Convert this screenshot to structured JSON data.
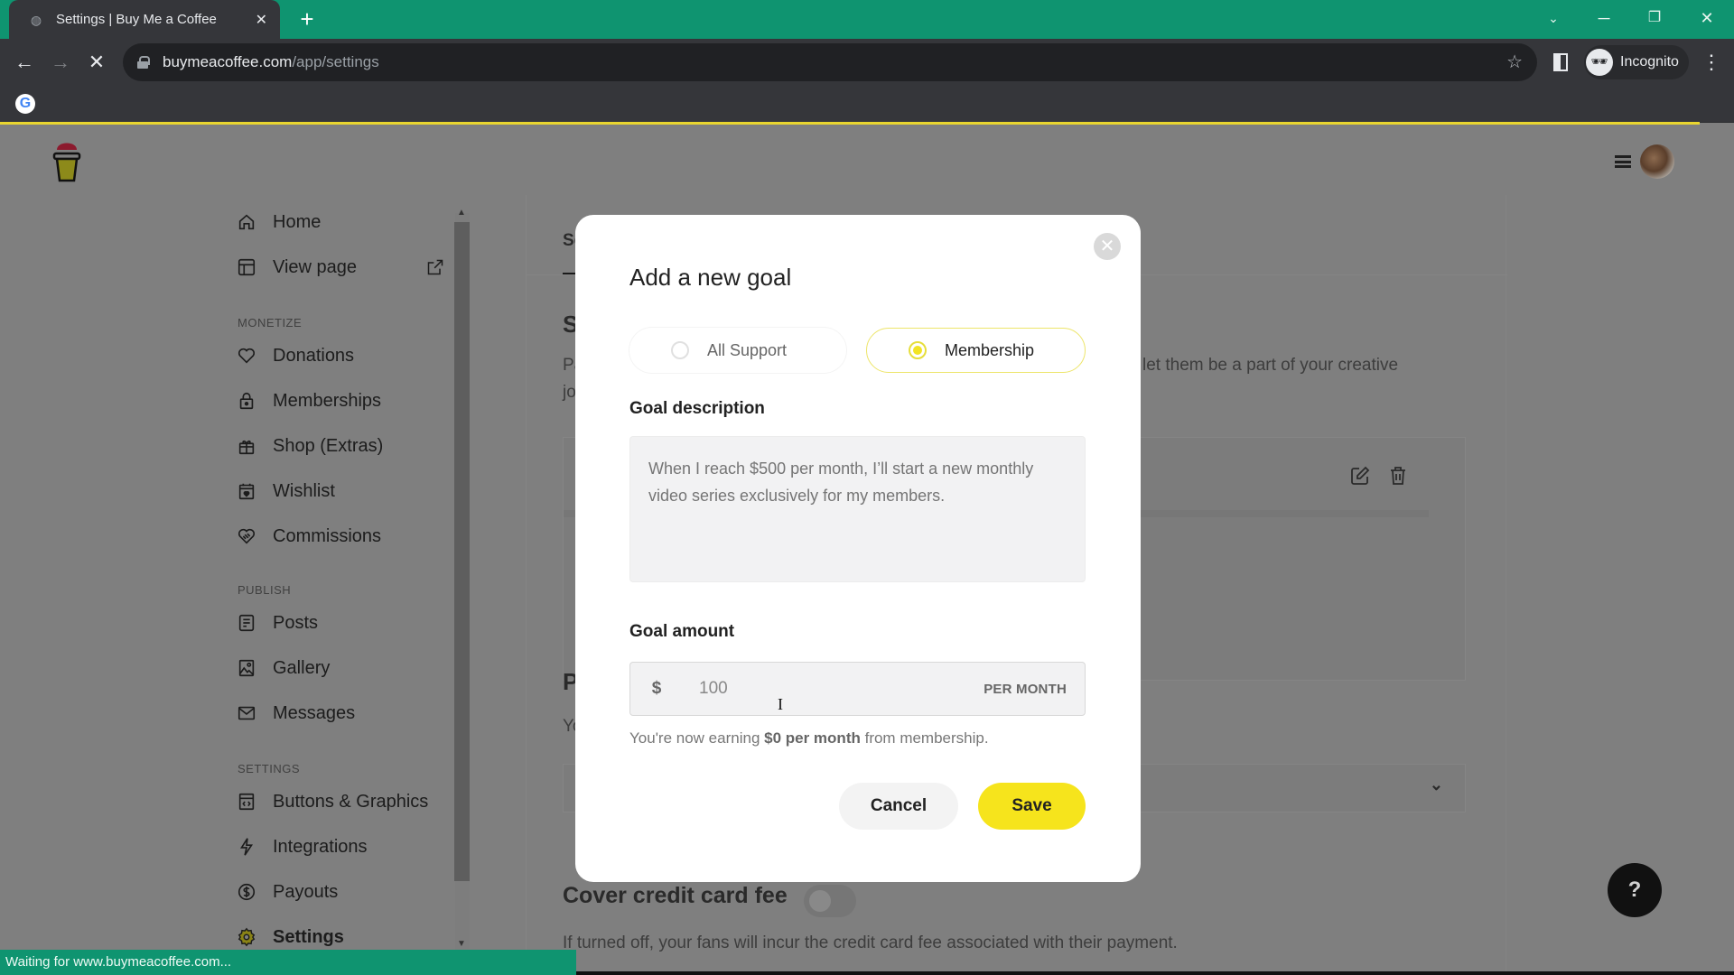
{
  "browser": {
    "tab_title": "Settings | Buy Me a Coffee",
    "tab_favicon": "globe-icon",
    "new_tab_label": "+",
    "url_host": "buymeacoffee.com",
    "url_path": "/app/settings",
    "profile_label": "Incognito",
    "status_text": "Waiting for www.buymeacoffee.com...",
    "loading_progress": 0.98,
    "window_controls": [
      "tab-search",
      "minimize",
      "restore",
      "close"
    ]
  },
  "sidebar": {
    "top_items": [
      {
        "label": "Home",
        "icon": "home-icon"
      },
      {
        "label": "View page",
        "icon": "layout-icon",
        "external": true
      }
    ],
    "sections": [
      {
        "title": "MONETIZE",
        "items": [
          {
            "label": "Donations",
            "icon": "heart-icon"
          },
          {
            "label": "Memberships",
            "icon": "lock-icon"
          },
          {
            "label": "Shop (Extras)",
            "icon": "gift-icon"
          },
          {
            "label": "Wishlist",
            "icon": "calendar-heart-icon"
          },
          {
            "label": "Commissions",
            "icon": "handshake-icon"
          }
        ]
      },
      {
        "title": "PUBLISH",
        "items": [
          {
            "label": "Posts",
            "icon": "document-icon"
          },
          {
            "label": "Gallery",
            "icon": "image-icon"
          },
          {
            "label": "Messages",
            "icon": "mail-icon"
          }
        ]
      },
      {
        "title": "SETTINGS",
        "items": [
          {
            "label": "Buttons & Graphics",
            "icon": "code-window-icon"
          },
          {
            "label": "Integrations",
            "icon": "lightning-icon"
          },
          {
            "label": "Payouts",
            "icon": "dollar-icon"
          },
          {
            "label": "Settings",
            "icon": "gear-icon",
            "active": true
          }
        ]
      }
    ]
  },
  "background": {
    "tab_partial": "Se",
    "section_heading_partial": "S",
    "section_text_line1_start": "Pa",
    "section_text_line1_end": "let them be a part of your creative",
    "section_text_line2_start": "jo",
    "second_heading_partial": "P",
    "second_text_partial": "Yo",
    "cover_fee_title": "Cover credit card fee",
    "cover_fee_enabled": false,
    "cover_fee_text": "If turned off, your fans will incur the credit card fee associated with their payment.",
    "help_label": "?"
  },
  "modal": {
    "title": "Add a new goal",
    "options": [
      {
        "label": "All Support",
        "selected": false
      },
      {
        "label": "Membership",
        "selected": true
      }
    ],
    "description_label": "Goal description",
    "description_placeholder": "When I reach $500 per month, I’ll start a new monthly video series exclusively for my members.",
    "description_value": "",
    "amount_label": "Goal amount",
    "currency_symbol": "$",
    "amount_placeholder": "100",
    "amount_value": "",
    "amount_unit": "PER MONTH",
    "earning_prefix": "You're now earning ",
    "earning_amount": "$0 per month",
    "earning_suffix": " from membership.",
    "cancel_label": "Cancel",
    "save_label": "Save"
  },
  "colors": {
    "accent_yellow": "#f6e41c",
    "chrome_green": "#0f9470",
    "overlay_gray": "#7f7f7f"
  }
}
